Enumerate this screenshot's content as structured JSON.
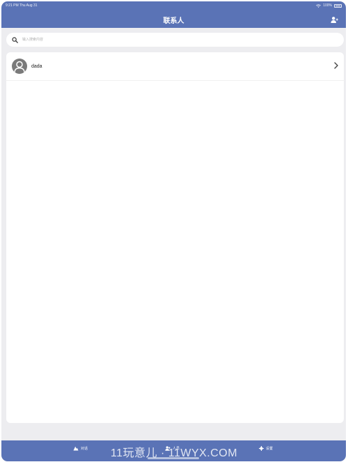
{
  "status": {
    "time": "9:21 PM",
    "date": "Thu Aug 31",
    "battery": "100%"
  },
  "header": {
    "title": "联系人",
    "add_icon": "add-contact-icon"
  },
  "search": {
    "placeholder": "输入搜索内容",
    "value": "",
    "icon": "search-icon"
  },
  "contacts": [
    {
      "name": "dada"
    }
  ],
  "tabs": [
    {
      "label": "对话",
      "icon": "chat-icon"
    },
    {
      "label": "人员",
      "icon": "contacts-icon"
    },
    {
      "label": "设置",
      "icon": "gear-icon"
    }
  ],
  "watermark": "11玩意儿 · 11WYX.COM",
  "colors": {
    "accent": "#5a73b6",
    "background": "#ededf0"
  }
}
